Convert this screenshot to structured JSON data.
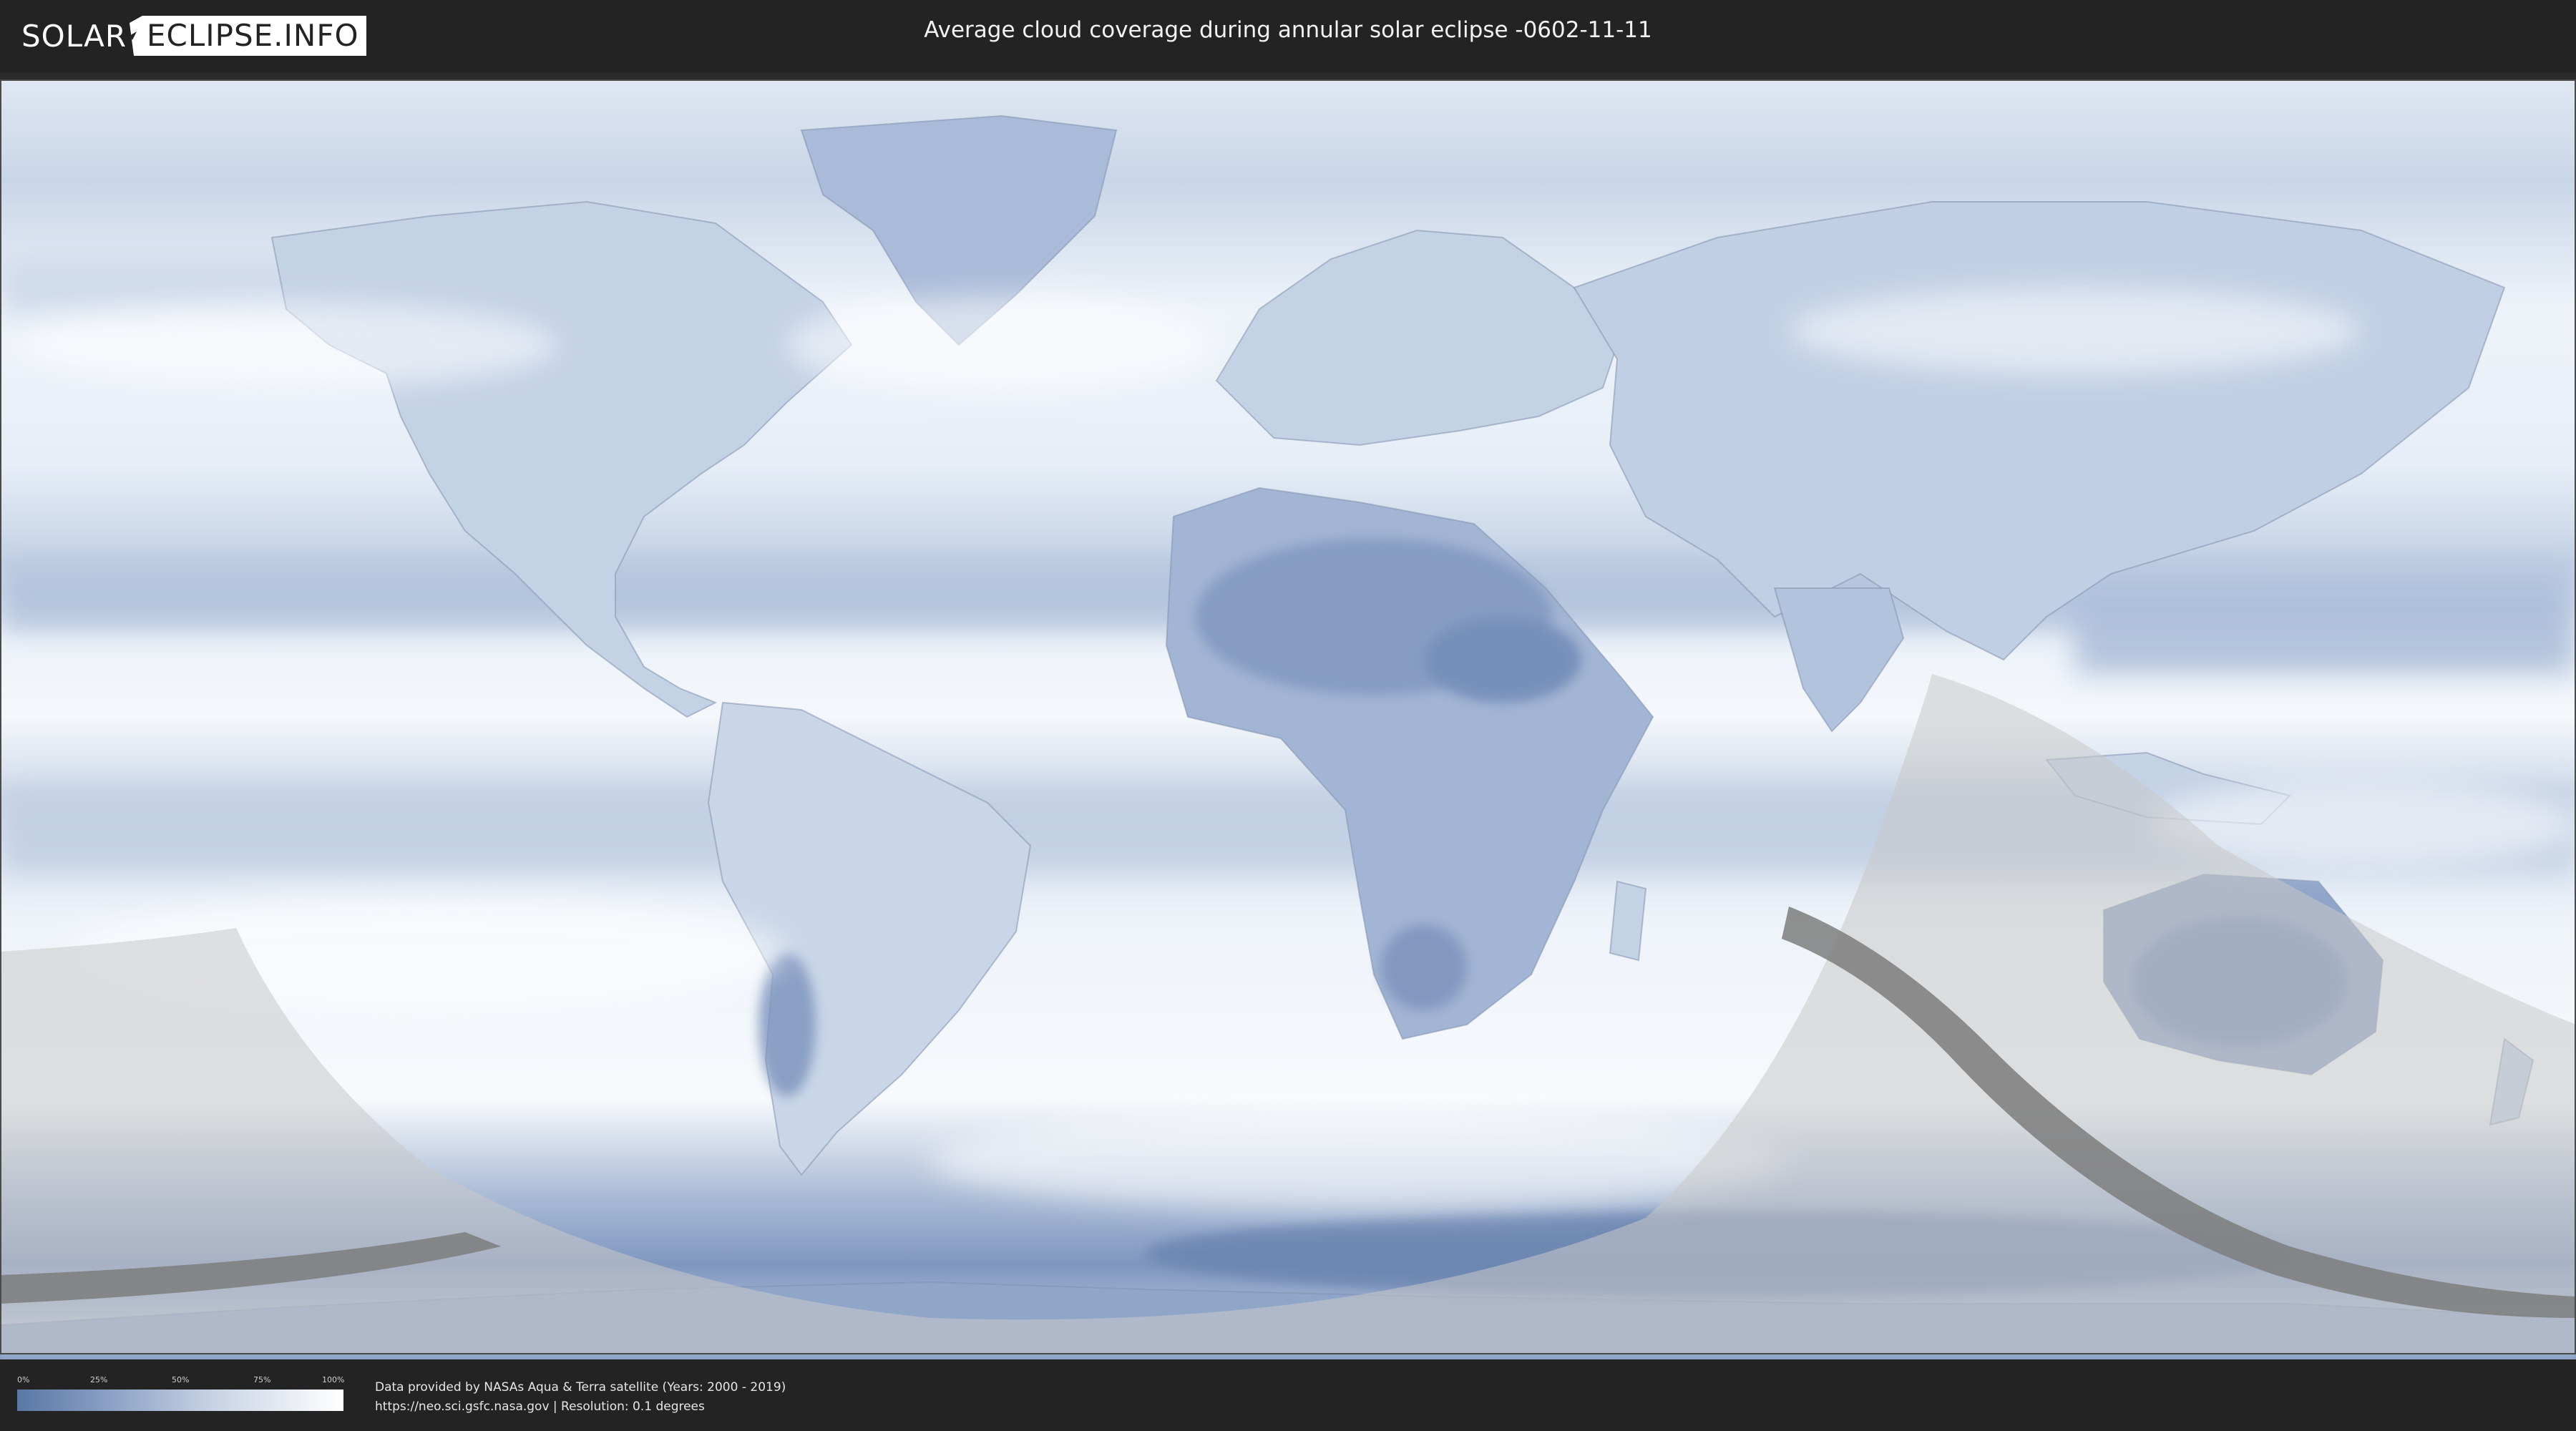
{
  "header": {
    "logo_left": "SOLAR",
    "logo_right": "ECLIPSE.INFO",
    "title": "Average cloud coverage during annular solar eclipse -0602-11-11"
  },
  "legend": {
    "ticks": [
      "0%",
      "25%",
      "50%",
      "75%",
      "100%"
    ],
    "gradient_colors": [
      "#5a77a6",
      "#8ea3c6",
      "#c8d3e4",
      "#ffffff"
    ]
  },
  "credits": {
    "line1": "Data provided by NASAs Aqua & Terra satellite (Years: 2000 - 2019)",
    "line2": "https://neo.sci.gsfc.nasa.gov | Resolution: 0.1 degrees"
  },
  "map": {
    "projection": "equirectangular world",
    "cloud_color_clear": "#5a77a6",
    "cloud_color_cloudy": "#ffffff",
    "eclipse_shadow_color": "#9a9a9a",
    "annularity_path_color": "#7d7d7d"
  }
}
